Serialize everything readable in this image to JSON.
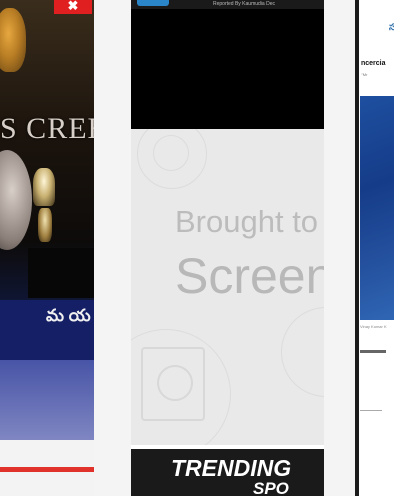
{
  "panel1": {
    "banner_text": "S CREE",
    "logo_text": "మ య",
    "close_glyph": "✖",
    "accent_color": "#e0322a"
  },
  "panel2": {
    "credit_text": "Reported By Kaumudia Dec",
    "ad_line1": "Brought to",
    "ad_line2": "Screen",
    "trending_line1": "TRENDING",
    "trending_line2": "SPO",
    "topbar_color": "#2a86c8"
  },
  "panel3": {
    "title_text": "స",
    "headline": "ncercia",
    "meta": "‘’Mr",
    "caption": "Vinay Kumar K",
    "accent_color": "#2d6ea8"
  }
}
